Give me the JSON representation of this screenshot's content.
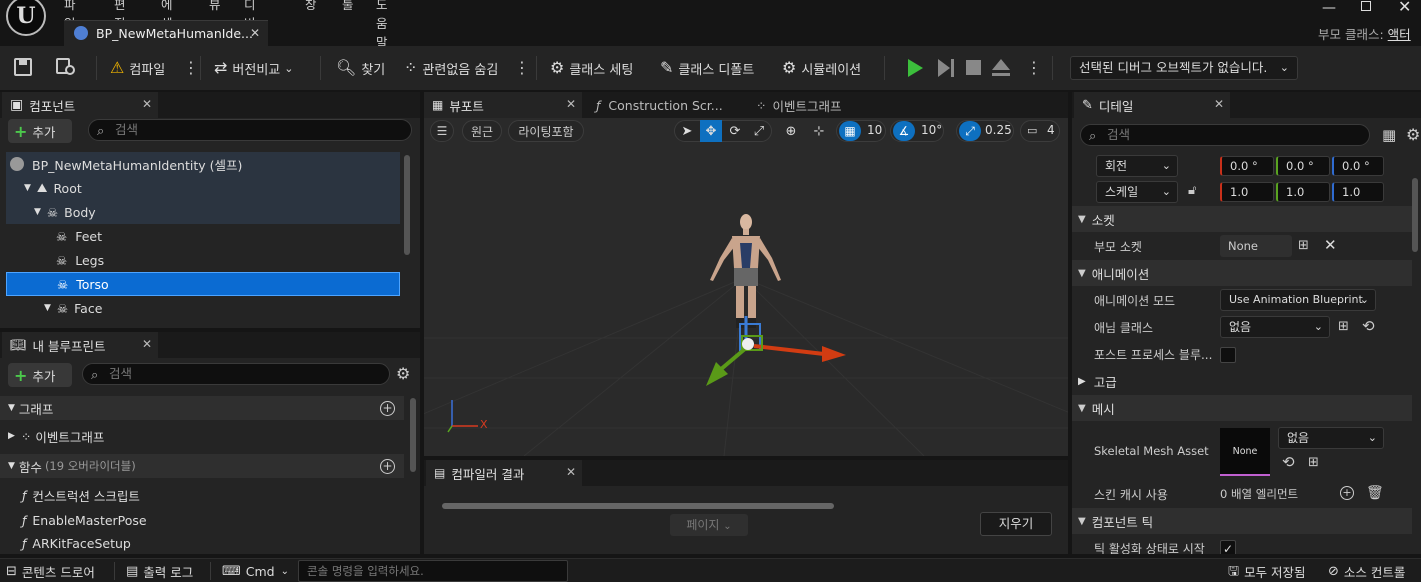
{
  "menu": {
    "items": [
      "파일",
      "편집",
      "에셋",
      "뷰",
      "디버그",
      "창",
      "툴",
      "도움말"
    ]
  },
  "document_tab": {
    "title": "BP_NewMetaHumanIde..."
  },
  "parent_class": {
    "label": "부모 클래스:",
    "value": "액터"
  },
  "toolbar": {
    "compile": "컴파일",
    "diff": "버전비교",
    "find": "찾기",
    "hide_unrelated": "관련없음 숨김",
    "class_settings": "클래스 세팅",
    "class_defaults": "클래스 디폴트",
    "simulation": "시뮬레이션",
    "debug_object": "선택된 디버그 오브젝트가 없습니다."
  },
  "components": {
    "tab_label": "컴포넌트",
    "add_label": "추가",
    "search_placeholder": "검색",
    "tree": [
      {
        "label": "BP_NewMetaHumanIdentity (셀프)",
        "depth": 0
      },
      {
        "label": "Root",
        "depth": 1
      },
      {
        "label": "Body",
        "depth": 2
      },
      {
        "label": "Feet",
        "depth": 3
      },
      {
        "label": "Legs",
        "depth": 3
      },
      {
        "label": "Torso",
        "depth": 3,
        "selected": true
      },
      {
        "label": "Face",
        "depth": 2
      }
    ]
  },
  "my_blueprint": {
    "tab_label": "내 블루프린트",
    "add_label": "추가",
    "search_placeholder": "검색",
    "graphs_header": "그래프",
    "event_graph": "이벤트그래프",
    "functions_header": "함수",
    "functions_count": "(19 오버라이더블)",
    "functions": [
      "컨스트럭션 스크립트",
      "EnableMasterPose",
      "ARKitFaceSetup"
    ]
  },
  "viewport": {
    "tabs": [
      "뷰포트",
      "Construction Scr...",
      "이벤트그래프"
    ],
    "perspective": "원근",
    "lit": "라이팅포함",
    "grid_snap": "10",
    "rotate_snap": "10°",
    "scale_snap": "0.25",
    "camera_speed": "4",
    "axis_x": "X"
  },
  "compiler": {
    "tab_label": "컴파일러 결과",
    "page_label": "페이지",
    "clear_label": "지우기"
  },
  "details": {
    "tab_label": "디테일",
    "search_placeholder": "검색",
    "rotation_label": "회전",
    "rotation": [
      "0.0 °",
      "0.0 °",
      "0.0 °"
    ],
    "scale_label": "스케일",
    "scale": [
      "1.0",
      "1.0",
      "1.0"
    ],
    "sockets_header": "소켓",
    "parent_socket_label": "부모 소켓",
    "parent_socket_value": "None",
    "animation_header": "애니메이션",
    "anim_mode_label": "애니메이션 모드",
    "anim_mode_value": "Use Animation Blueprint",
    "anim_class_label": "애님 클래스",
    "anim_class_value": "없음",
    "post_process_label": "포스트 프로세스 블루...",
    "advanced_header": "고급",
    "mesh_header": "메시",
    "skeletal_mesh_label": "Skeletal Mesh Asset",
    "skeletal_mesh_thumb": "None",
    "skeletal_mesh_value": "없음",
    "skin_cache_label": "스킨 캐시 사용",
    "skin_cache_value": "0 배열 엘리먼트",
    "component_tick_header": "컴포넌트 틱",
    "tick_enabled_label": "틱 활성화 상태로 시작"
  },
  "status_bar": {
    "content_drawer": "콘텐츠 드로어",
    "output_log": "출력 로그",
    "cmd": "Cmd",
    "cmd_placeholder": "콘솔 명령을 입력하세요.",
    "save_all": "모두 저장됨",
    "source_control": "소스 컨트롤"
  },
  "colors": {
    "accent": "#0e70c0",
    "selected_row": "#0b6bd2",
    "play": "#3cbf3c"
  }
}
